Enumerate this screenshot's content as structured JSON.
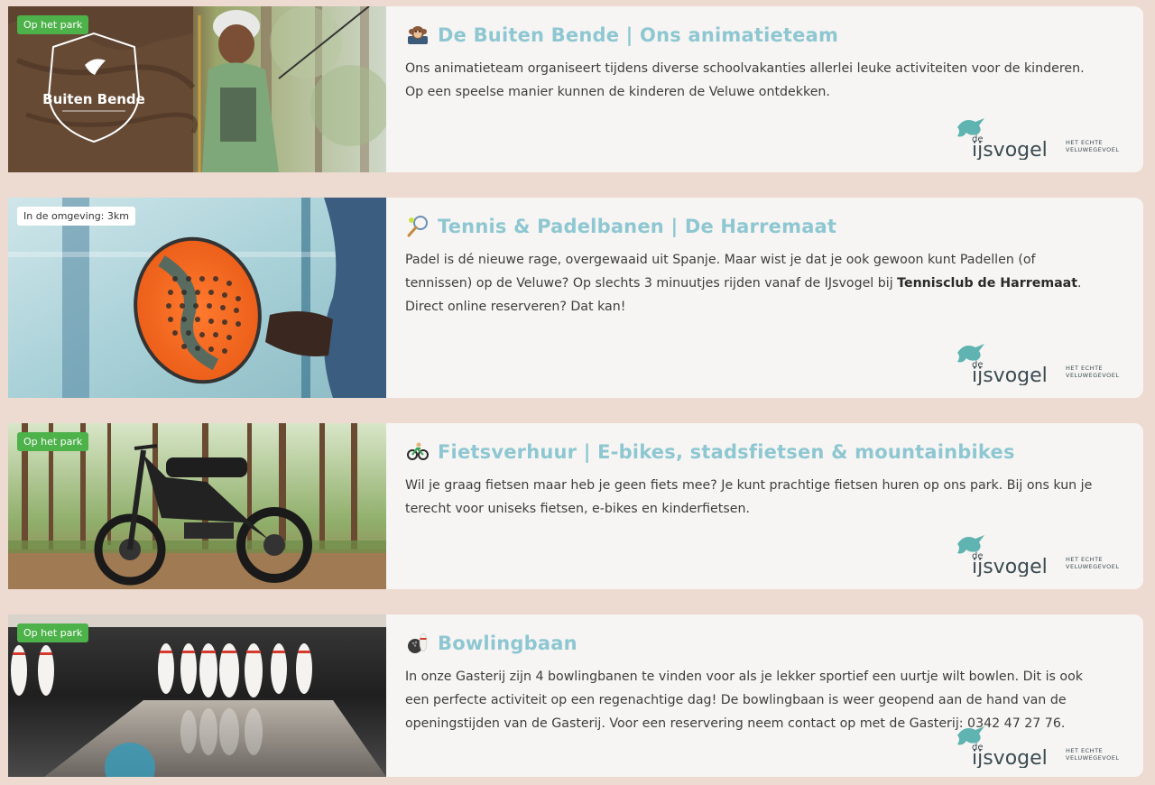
{
  "cards": [
    {
      "badge": "Op het park",
      "title": "De Buiten Bende | Ons animatieteam",
      "icon": "monkey-icon",
      "desc": "Ons animatieteam organiseert tijdens diverse schoolvakanties allerlei leuke activiteiten voor de kinderen. Op een speelse manier kunnen de kinderen de Veluwe ontdekken.",
      "image_label": "Buiten Bende"
    },
    {
      "badge": "In de omgeving: 3km",
      "title": "Tennis & Padelbanen | De Harremaat",
      "icon": "tennis-racket-icon",
      "desc_part1": "Padel is dé nieuwe rage, overgewaaid uit Spanje. Maar wist je dat je ook gewoon kunt Padellen (of tennissen) op de Veluwe? Op slechts 3 minuutjes rijden vanaf de IJsvogel bij ",
      "desc_bold": "Tennisclub de Harremaat",
      "desc_part2": ". Direct online reserveren? Dat kan!"
    },
    {
      "badge": "Op het park",
      "title": "Fietsverhuur | E-bikes, stadsfietsen & mountainbikes",
      "icon": "bicycle-icon",
      "desc": "Wil je graag fietsen maar heb je geen fiets mee? Je kunt prachtige fietsen huren op ons park. Bij ons kun je terecht voor uniseks fietsen, e-bikes en kinderfietsen."
    },
    {
      "badge": "Op het park",
      "title": "Bowlingbaan",
      "icon": "bowling-icon",
      "desc": "In onze Gasterij zijn 4 bowlingbanen te vinden voor als je lekker sportief een uurtje wilt bowlen. Dit is ook een perfecte activiteit op een regenachtige dag! De bowlingbaan is weer geopend aan de hand van de openingstijden van de Gasterij. Voor een reservering neem contact op met de Gasterij: 0342 47 27 76."
    }
  ],
  "logo": {
    "prefix": "de",
    "name": "ijsvogel",
    "tagline_1": "HET ECHTE",
    "tagline_2": "VELUWEGEVOEL",
    "icon": "kingfisher-icon"
  },
  "colors": {
    "background": "#eddbd1",
    "title": "#8ec7d2",
    "badge_green": "#4db24a",
    "logo_teal": "#5fb3b0",
    "logo_text": "#3b4b52"
  }
}
